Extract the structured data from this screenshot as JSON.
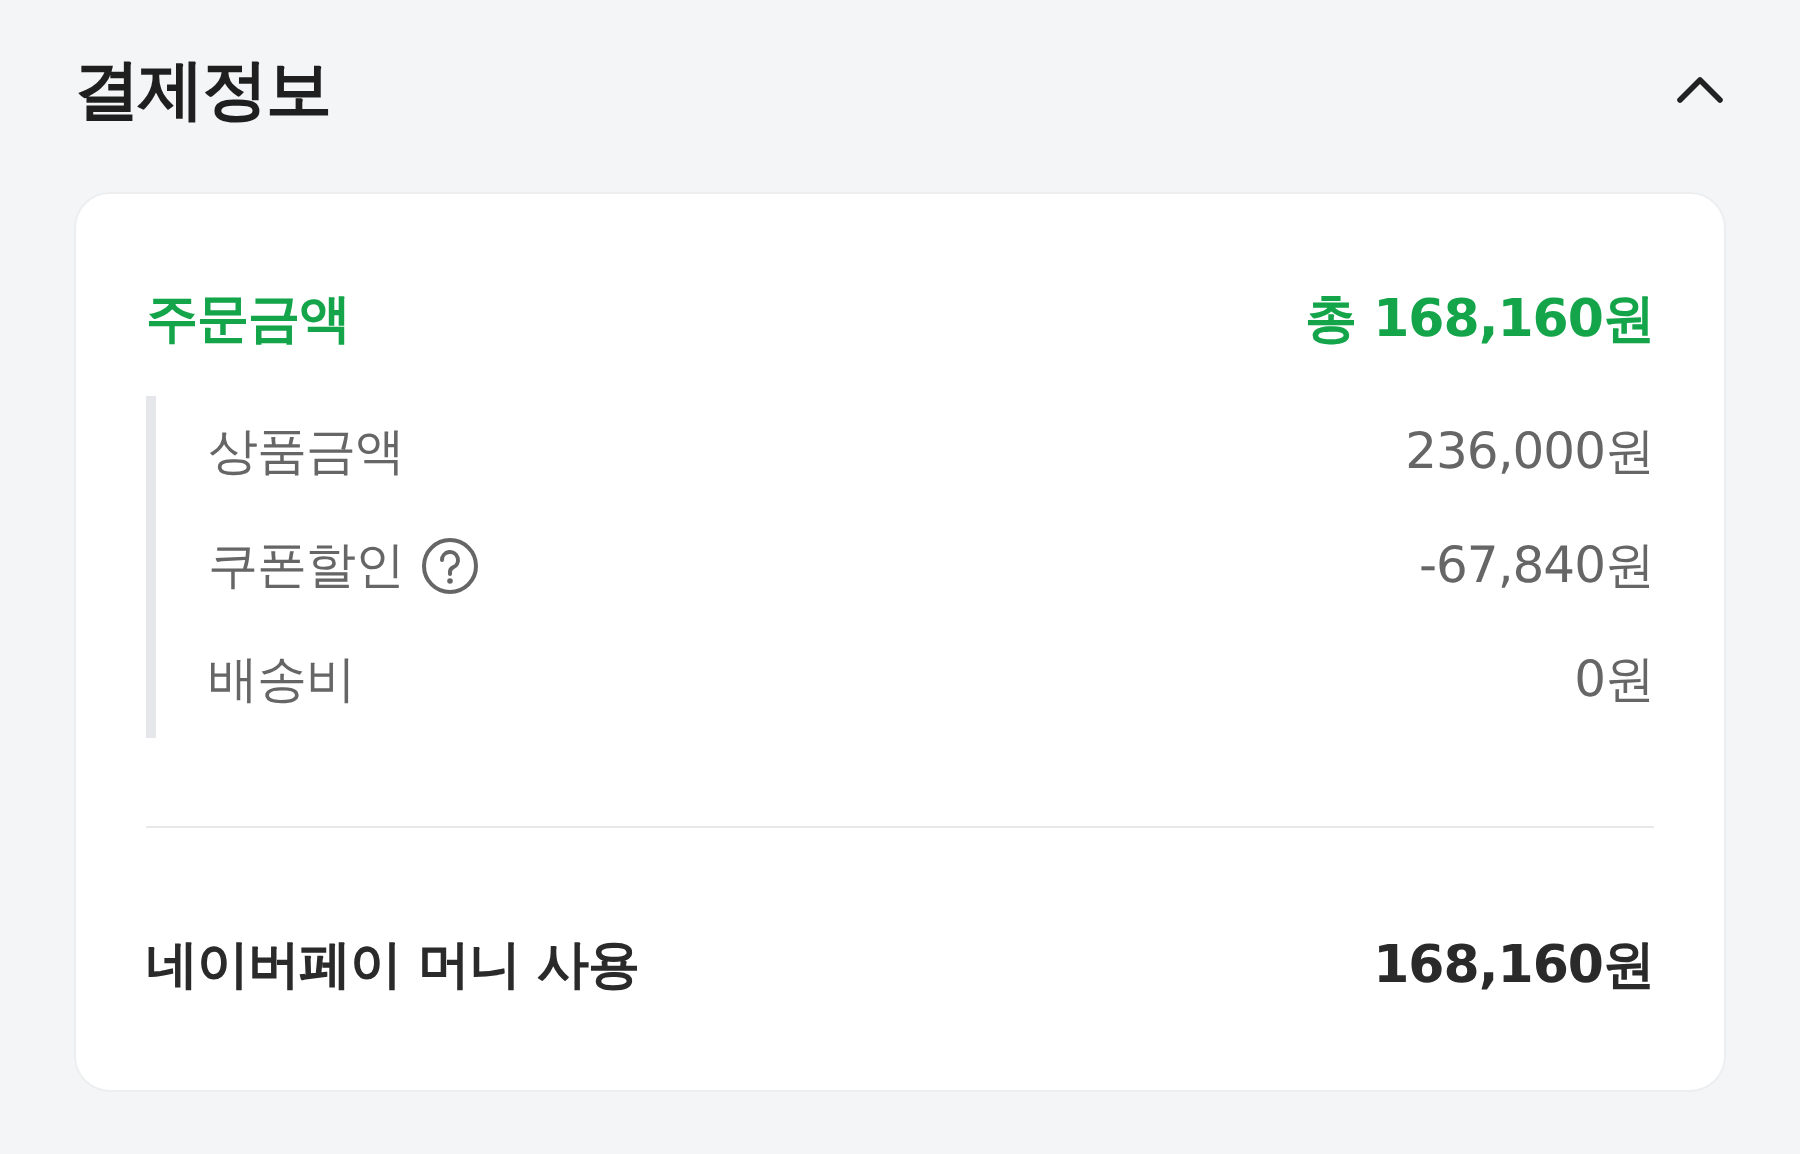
{
  "header": {
    "title": "결제정보",
    "expanded": true
  },
  "order": {
    "label": "주문금액",
    "total": "총 168,160원"
  },
  "breakdown": [
    {
      "label": "상품금액",
      "amount": "236,000원",
      "help": false
    },
    {
      "label": "쿠폰할인",
      "amount": "-67,840원",
      "help": true
    },
    {
      "label": "배송비",
      "amount": "0원",
      "help": false
    }
  ],
  "payment": {
    "label": "네이버페이 머니 사용",
    "amount": "168,160원"
  }
}
